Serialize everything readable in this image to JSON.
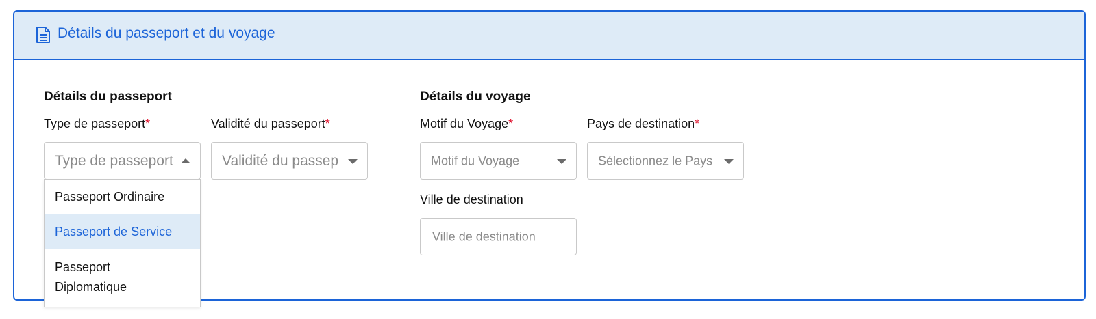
{
  "panel": {
    "title": "Détails du passeport et du voyage",
    "icon": "document-icon",
    "accent_color": "#1c64d8",
    "header_bg": "#deebf7"
  },
  "passport": {
    "section_title": "Détails du passeport",
    "type": {
      "label": "Type de passeport",
      "required_mark": "*",
      "placeholder": "Type de passeport",
      "expanded": true,
      "options": [
        "Passeport Ordinaire",
        "Passeport de Service",
        "Passeport Diplomatique"
      ],
      "highlighted_option": "Passeport de Service"
    },
    "validity": {
      "label": "Validité du passeport",
      "required_mark": "*",
      "placeholder": "Validité du passep"
    }
  },
  "travel": {
    "section_title": "Détails du voyage",
    "purpose": {
      "label": "Motif du Voyage",
      "required_mark": "*",
      "placeholder": "Motif du Voyage"
    },
    "country": {
      "label": "Pays de destination",
      "required_mark": "*",
      "placeholder": "Sélectionnez le Pays"
    },
    "city": {
      "label": "Ville de destination",
      "placeholder": "Ville de destination"
    }
  },
  "colors": {
    "required": "#e0102c",
    "placeholder": "#8a8a8a",
    "border": "#c9c9c9"
  }
}
